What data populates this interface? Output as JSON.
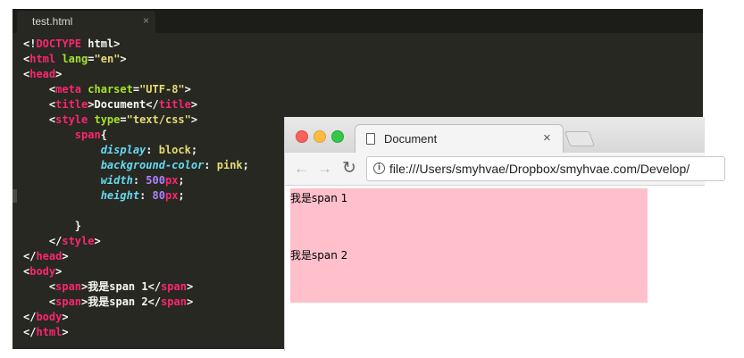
{
  "editor": {
    "tab_label": "test.html",
    "tab_close": "×",
    "lines": [
      [
        {
          "t": "<!",
          "c": "tk-p"
        },
        {
          "t": "DOCTYPE",
          "c": "tk-t"
        },
        {
          "t": " html>",
          "c": "tk-p"
        }
      ],
      [
        {
          "t": "<",
          "c": "tk-p"
        },
        {
          "t": "html",
          "c": "tk-t"
        },
        {
          "t": " ",
          "c": "tk-p"
        },
        {
          "t": "lang",
          "c": "tk-a"
        },
        {
          "t": "=",
          "c": "tk-p"
        },
        {
          "t": "\"en\"",
          "c": "tk-s"
        },
        {
          "t": ">",
          "c": "tk-p"
        }
      ],
      [
        {
          "t": "<",
          "c": "tk-p"
        },
        {
          "t": "head",
          "c": "tk-t"
        },
        {
          "t": ">",
          "c": "tk-p"
        }
      ],
      [
        {
          "t": "    <",
          "c": "tk-p"
        },
        {
          "t": "meta",
          "c": "tk-t"
        },
        {
          "t": " ",
          "c": "tk-p"
        },
        {
          "t": "charset",
          "c": "tk-a"
        },
        {
          "t": "=",
          "c": "tk-p"
        },
        {
          "t": "\"UTF-8\"",
          "c": "tk-s"
        },
        {
          "t": ">",
          "c": "tk-p"
        }
      ],
      [
        {
          "t": "    <",
          "c": "tk-p"
        },
        {
          "t": "title",
          "c": "tk-t"
        },
        {
          "t": ">Document</",
          "c": "tk-p"
        },
        {
          "t": "title",
          "c": "tk-t"
        },
        {
          "t": ">",
          "c": "tk-p"
        }
      ],
      [
        {
          "t": "    <",
          "c": "tk-p"
        },
        {
          "t": "style",
          "c": "tk-t"
        },
        {
          "t": " ",
          "c": "tk-p"
        },
        {
          "t": "type",
          "c": "tk-a"
        },
        {
          "t": "=",
          "c": "tk-p"
        },
        {
          "t": "\"text/css\"",
          "c": "tk-s"
        },
        {
          "t": ">",
          "c": "tk-p"
        }
      ],
      [
        {
          "t": "        ",
          "c": "tk-p"
        },
        {
          "t": "span",
          "c": "tk-t"
        },
        {
          "t": "{",
          "c": "tk-p"
        }
      ],
      [
        {
          "t": "            ",
          "c": "tk-p"
        },
        {
          "t": "display",
          "c": "tk-k"
        },
        {
          "t": ": ",
          "c": "tk-p"
        },
        {
          "t": "block",
          "c": "tk-v"
        },
        {
          "t": ";",
          "c": "tk-p"
        }
      ],
      [
        {
          "t": "            ",
          "c": "tk-p"
        },
        {
          "t": "background-color",
          "c": "tk-k"
        },
        {
          "t": ": ",
          "c": "tk-p"
        },
        {
          "t": "pink",
          "c": "tk-v"
        },
        {
          "t": ";",
          "c": "tk-p"
        }
      ],
      [
        {
          "t": "            ",
          "c": "tk-p"
        },
        {
          "t": "width",
          "c": "tk-k"
        },
        {
          "t": ": ",
          "c": "tk-p"
        },
        {
          "t": "500",
          "c": "tk-n"
        },
        {
          "t": "px",
          "c": "tk-u"
        },
        {
          "t": ";",
          "c": "tk-p"
        }
      ],
      [
        {
          "t": "            ",
          "c": "tk-p"
        },
        {
          "t": "height",
          "c": "tk-k"
        },
        {
          "t": ": ",
          "c": "tk-p"
        },
        {
          "t": "80",
          "c": "tk-n"
        },
        {
          "t": "px",
          "c": "tk-u"
        },
        {
          "t": ";",
          "c": "tk-p"
        }
      ],
      [],
      [
        {
          "t": "        }",
          "c": "tk-p"
        }
      ],
      [
        {
          "t": "    </",
          "c": "tk-p"
        },
        {
          "t": "style",
          "c": "tk-t"
        },
        {
          "t": ">",
          "c": "tk-p"
        }
      ],
      [
        {
          "t": "</",
          "c": "tk-p"
        },
        {
          "t": "head",
          "c": "tk-t"
        },
        {
          "t": ">",
          "c": "tk-p"
        }
      ],
      [
        {
          "t": "<",
          "c": "tk-p"
        },
        {
          "t": "body",
          "c": "tk-t"
        },
        {
          "t": ">",
          "c": "tk-p"
        }
      ],
      [
        {
          "t": "    <",
          "c": "tk-p"
        },
        {
          "t": "span",
          "c": "tk-t"
        },
        {
          "t": ">我是span 1</",
          "c": "tk-p"
        },
        {
          "t": "span",
          "c": "tk-t"
        },
        {
          "t": ">",
          "c": "tk-p"
        }
      ],
      [
        {
          "t": "    <",
          "c": "tk-p"
        },
        {
          "t": "span",
          "c": "tk-t"
        },
        {
          "t": ">我是span 2</",
          "c": "tk-p"
        },
        {
          "t": "span",
          "c": "tk-t"
        },
        {
          "t": ">",
          "c": "tk-p"
        }
      ],
      [
        {
          "t": "</",
          "c": "tk-p"
        },
        {
          "t": "body",
          "c": "tk-t"
        },
        {
          "t": ">",
          "c": "tk-p"
        }
      ],
      [
        {
          "t": "</",
          "c": "tk-p"
        },
        {
          "t": "html",
          "c": "tk-t"
        },
        {
          "t": ">",
          "c": "tk-p"
        }
      ]
    ]
  },
  "browser": {
    "tab_title": "Document",
    "tab_close": "×",
    "back_icon": "arrow-left",
    "forward_icon": "arrow-right",
    "reload_icon": "reload",
    "info_icon": "info-circle",
    "url": "file:///Users/smyhvae/Dropbox/smyhvae.com/Develop/",
    "page": {
      "span1": "我是span 1",
      "span2": "我是span 2",
      "span_color": "#ffc0cb"
    }
  }
}
